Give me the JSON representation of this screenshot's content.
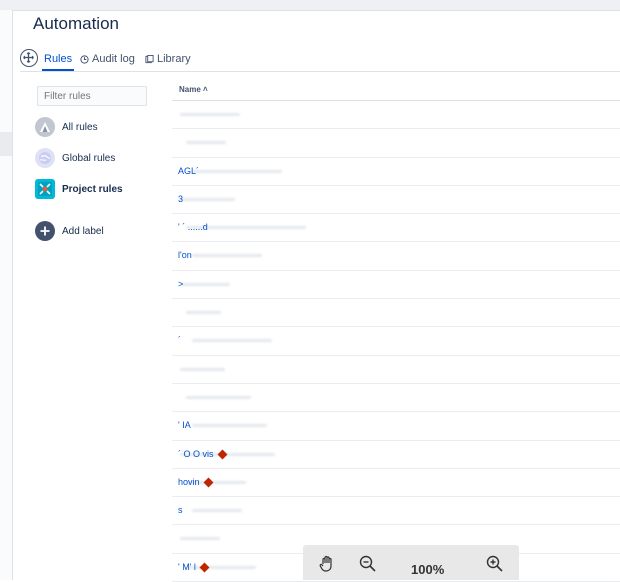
{
  "page": {
    "title": "Automation"
  },
  "tabs": [
    {
      "label": "Rules",
      "active": true
    },
    {
      "label": "Audit log",
      "active": false
    },
    {
      "label": "Library",
      "active": false
    }
  ],
  "sidebar": {
    "filter_placeholder": "Filter rules",
    "items": [
      {
        "label": "All rules",
        "icon": "all-rules-icon"
      },
      {
        "label": "Global rules",
        "icon": "globe-icon"
      },
      {
        "label": "Project rules",
        "icon": "project-icon"
      }
    ],
    "add_label": "Add label"
  },
  "table": {
    "header": "Name ˄",
    "rows": [
      {
        "text": ""
      },
      {
        "text": ""
      },
      {
        "text": "AGL´"
      },
      {
        "text": "3"
      },
      {
        "text": "' ´ ......d"
      },
      {
        "text": "l'on"
      },
      {
        "text": ">"
      },
      {
        "text": ""
      },
      {
        "text": "´"
      },
      {
        "text": ""
      },
      {
        "text": ""
      },
      {
        "text": "' IA"
      },
      {
        "text": "´ O O vis",
        "warning": true
      },
      {
        "text": "hovin",
        "warning": true
      },
      {
        "text": "s"
      },
      {
        "text": ""
      },
      {
        "text": "' M' l",
        "warning": true
      }
    ]
  },
  "zoom": {
    "level": "100%"
  },
  "colors": {
    "accent": "#0052cc",
    "warning": "#bf2600",
    "text": "#172b4d"
  }
}
